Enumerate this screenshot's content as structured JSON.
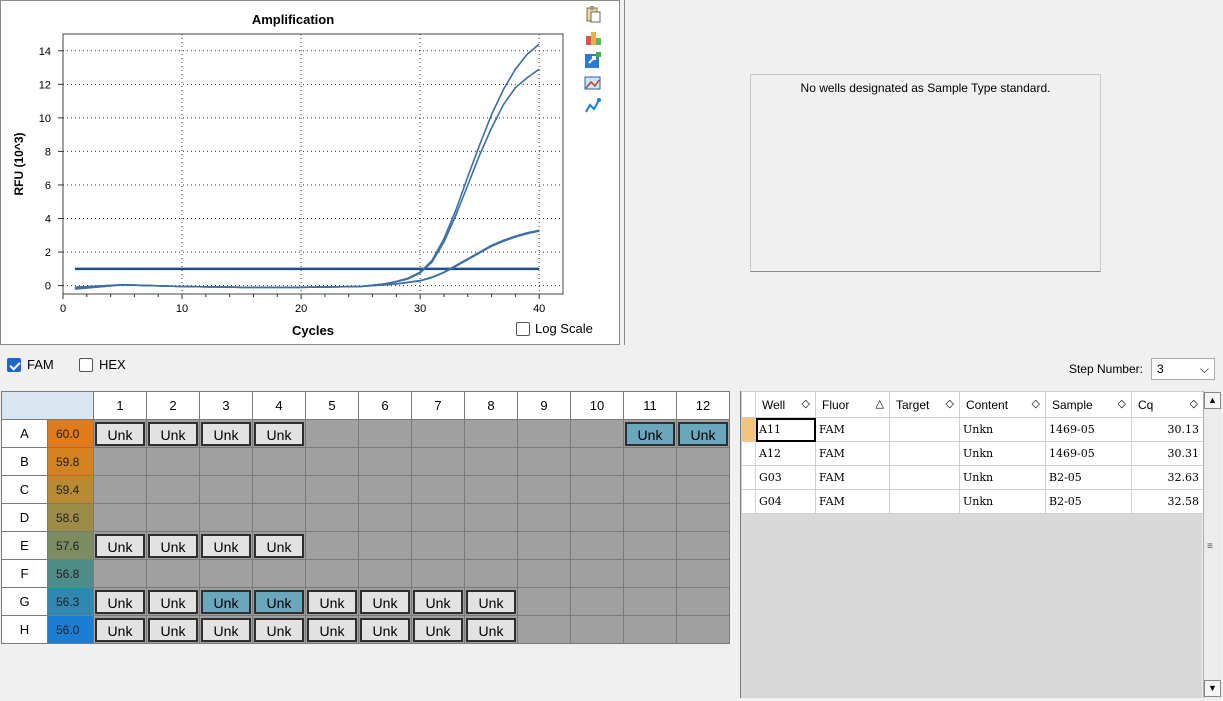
{
  "chart": {
    "title": "Amplification",
    "xlabel": "Cycles",
    "ylabel": "RFU (10^3)",
    "log_scale_label": "Log Scale",
    "log_scale_checked": false
  },
  "chart_data": {
    "type": "line",
    "title": "Amplification",
    "xlabel": "Cycles",
    "ylabel": "RFU (10^3)",
    "xlim": [
      0,
      42
    ],
    "ylim": [
      -0.5,
      15
    ],
    "x_ticks": [
      0,
      10,
      20,
      30,
      40
    ],
    "y_ticks": [
      0,
      2,
      4,
      6,
      8,
      10,
      12,
      14
    ],
    "grid": true,
    "threshold": 1.0,
    "series": [
      {
        "x": [
          1,
          5,
          10,
          15,
          20,
          25,
          27,
          28,
          29,
          30,
          31,
          32,
          33,
          34,
          35,
          36,
          37,
          38,
          39,
          40
        ],
        "values": [
          -0.1,
          0.05,
          -0.05,
          -0.1,
          -0.1,
          -0.05,
          0.1,
          0.25,
          0.45,
          0.8,
          1.5,
          2.8,
          4.5,
          6.5,
          8.4,
          10.2,
          11.7,
          12.9,
          13.8,
          14.4
        ]
      },
      {
        "x": [
          1,
          5,
          10,
          15,
          20,
          25,
          27,
          28,
          29,
          30,
          31,
          32,
          33,
          34,
          35,
          36,
          37,
          38,
          39,
          40
        ],
        "values": [
          -0.1,
          0.05,
          -0.05,
          -0.1,
          -0.1,
          -0.05,
          0.1,
          0.22,
          0.4,
          0.75,
          1.4,
          2.6,
          4.2,
          6.0,
          7.8,
          9.4,
          10.8,
          11.8,
          12.4,
          12.9
        ]
      },
      {
        "x": [
          1,
          5,
          10,
          15,
          20,
          25,
          28,
          30,
          31,
          32,
          33,
          34,
          35,
          36,
          37,
          38,
          39,
          40
        ],
        "values": [
          -0.2,
          0.05,
          -0.05,
          -0.1,
          -0.1,
          -0.05,
          0.1,
          0.3,
          0.5,
          0.8,
          1.2,
          1.6,
          2.0,
          2.4,
          2.7,
          2.95,
          3.15,
          3.3
        ]
      },
      {
        "x": [
          1,
          5,
          10,
          15,
          20,
          25,
          28,
          30,
          31,
          32,
          33,
          34,
          35,
          36,
          37,
          38,
          39,
          40
        ],
        "values": [
          -0.2,
          0.05,
          -0.05,
          -0.1,
          -0.1,
          -0.05,
          0.1,
          0.28,
          0.48,
          0.78,
          1.15,
          1.55,
          1.95,
          2.35,
          2.65,
          2.9,
          3.1,
          3.25
        ]
      }
    ]
  },
  "standard_curve": {
    "message": "No wells designated as Sample Type standard."
  },
  "fluors": [
    {
      "label": "FAM",
      "checked": true
    },
    {
      "label": "HEX",
      "checked": false
    }
  ],
  "step": {
    "label": "Step Number:",
    "value": "3"
  },
  "plate": {
    "columns": [
      "1",
      "2",
      "3",
      "4",
      "5",
      "6",
      "7",
      "8",
      "9",
      "10",
      "11",
      "12"
    ],
    "rows": [
      {
        "label": "A",
        "temp": "60.0",
        "temp_color": "#e07a1a",
        "wells": [
          "Unk",
          "Unk",
          "Unk",
          "Unk",
          "",
          "",
          "",
          "",
          "",
          "",
          "Unk*",
          "Unk*"
        ]
      },
      {
        "label": "B",
        "temp": "59.8",
        "temp_color": "#d2821e",
        "wells": [
          "",
          "",
          "",
          "",
          "",
          "",
          "",
          "",
          "",
          "",
          "",
          ""
        ]
      },
      {
        "label": "C",
        "temp": "59.4",
        "temp_color": "#b88a32",
        "wells": [
          "",
          "",
          "",
          "",
          "",
          "",
          "",
          "",
          "",
          "",
          "",
          ""
        ]
      },
      {
        "label": "D",
        "temp": "58.6",
        "temp_color": "#9c8c48",
        "wells": [
          "",
          "",
          "",
          "",
          "",
          "",
          "",
          "",
          "",
          "",
          "",
          ""
        ]
      },
      {
        "label": "E",
        "temp": "57.6",
        "temp_color": "#7a8c60",
        "wells": [
          "Unk",
          "Unk",
          "Unk",
          "Unk",
          "",
          "",
          "",
          "",
          "",
          "",
          "",
          ""
        ]
      },
      {
        "label": "F",
        "temp": "56.8",
        "temp_color": "#4e8c88",
        "wells": [
          "",
          "",
          "",
          "",
          "",
          "",
          "",
          "",
          "",
          "",
          "",
          ""
        ]
      },
      {
        "label": "G",
        "temp": "56.3",
        "temp_color": "#2f88b0",
        "wells": [
          "Unk",
          "Unk",
          "Unk*",
          "Unk*",
          "Unk",
          "Unk",
          "Unk",
          "Unk",
          "",
          "",
          "",
          ""
        ]
      },
      {
        "label": "H",
        "temp": "56.0",
        "temp_color": "#1a7fd4",
        "wells": [
          "Unk",
          "Unk",
          "Unk",
          "Unk",
          "Unk",
          "Unk",
          "Unk",
          "Unk",
          "",
          "",
          "",
          ""
        ]
      }
    ]
  },
  "results": {
    "headers": [
      {
        "label": "Well",
        "sort": "◇"
      },
      {
        "label": "Fluor",
        "sort": "△"
      },
      {
        "label": "Target",
        "sort": "◇"
      },
      {
        "label": "Content",
        "sort": "◇"
      },
      {
        "label": "Sample",
        "sort": "◇"
      },
      {
        "label": "Cq",
        "sort": "◇"
      }
    ],
    "rows": [
      {
        "well": "A11",
        "fluor": "FAM",
        "target": "",
        "content": "Unkn",
        "sample": "1469-05",
        "cq": "30.13"
      },
      {
        "well": "A12",
        "fluor": "FAM",
        "target": "",
        "content": "Unkn",
        "sample": "1469-05",
        "cq": "30.31"
      },
      {
        "well": "G03",
        "fluor": "FAM",
        "target": "",
        "content": "Unkn",
        "sample": "B2-05",
        "cq": "32.63"
      },
      {
        "well": "G04",
        "fluor": "FAM",
        "target": "",
        "content": "Unkn",
        "sample": "B2-05",
        "cq": "32.58"
      }
    ]
  },
  "icons": [
    "clipboard-icon",
    "paint-icon",
    "export-icon",
    "image-icon",
    "chart-line-icon"
  ]
}
